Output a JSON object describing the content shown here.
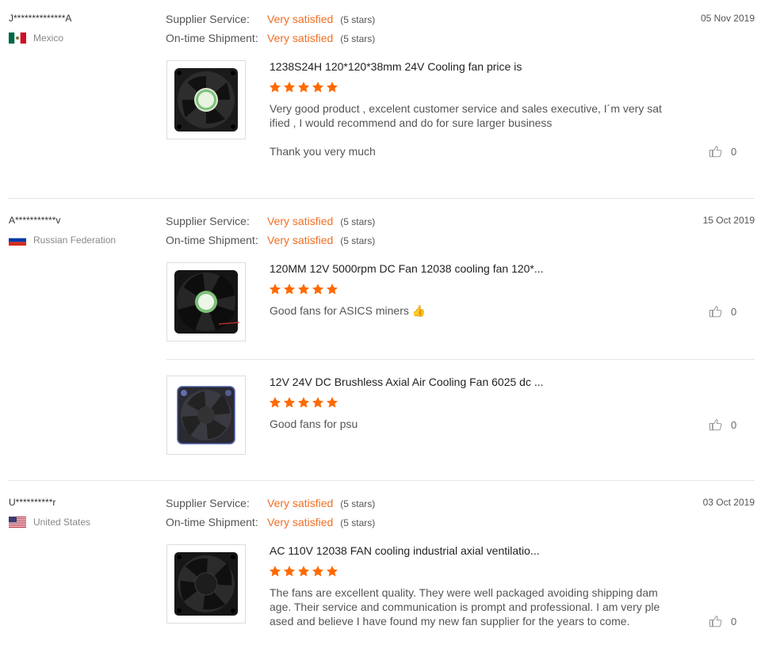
{
  "labels": {
    "supplier_service": "Supplier Service:",
    "ontime_shipment": "On-time Shipment:"
  },
  "colors": {
    "accent": "#f06f23",
    "star": "#ff6a00"
  },
  "reviews": [
    {
      "buyer": "J**************A",
      "country": "Mexico",
      "flag": "mexico-flag-icon",
      "date": "05 Nov 2019",
      "supplier_service": "Very satisfied",
      "supplier_stars": "(5 stars)",
      "ontime_shipment": "Very satisfied",
      "ontime_stars": "(5 stars)",
      "items": [
        {
          "title": "1238S24H 120*120*38mm 24V Cooling fan price is",
          "rating": 5,
          "comment": "Very good product , excelent customer service and sales executive, I´m very satified , I would recommend and do for sure larger business",
          "comment2": "Thank you  very much",
          "likes": "0"
        }
      ]
    },
    {
      "buyer": "A***********v",
      "country": "Russian Federation",
      "flag": "russia-flag-icon",
      "date": "15 Oct 2019",
      "supplier_service": "Very satisfied",
      "supplier_stars": "(5 stars)",
      "ontime_shipment": "Very satisfied",
      "ontime_stars": "(5 stars)",
      "items": [
        {
          "title": "120MM 12V 5000rpm DC Fan 12038 cooling fan 120*...",
          "rating": 5,
          "comment": "Good fans for ASICS miners",
          "emoji": "👍",
          "likes": "0"
        },
        {
          "title": "12V 24V DC Brushless Axial Air Cooling Fan 6025 dc ...",
          "rating": 5,
          "comment": "Good fans for psu",
          "likes": "0"
        }
      ]
    },
    {
      "buyer": "U**********r",
      "country": "United States",
      "flag": "usa-flag-icon",
      "date": "03 Oct 2019",
      "supplier_service": "Very satisfied",
      "supplier_stars": "(5 stars)",
      "ontime_shipment": "Very satisfied",
      "ontime_stars": "(5 stars)",
      "items": [
        {
          "title": "AC 110V 12038 FAN cooling industrial axial ventilatio...",
          "rating": 5,
          "comment": "The fans are excellent quality.  They were well packaged avoiding shipping damage.  Their service and communication is prompt and professional. I am very pleased and believe I have found my new fan supplier for the years to come.",
          "likes": "0"
        }
      ]
    }
  ]
}
